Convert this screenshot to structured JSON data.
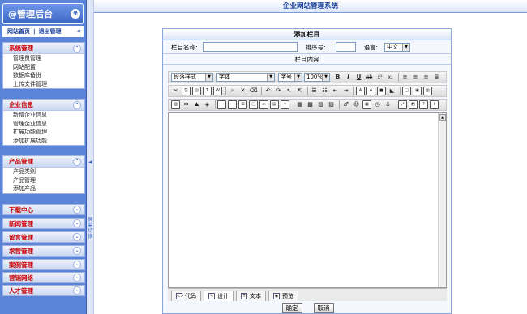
{
  "window": {
    "title": "企业网站管理系统"
  },
  "sidebar": {
    "brand": "@管理后台",
    "links": {
      "home": "网站首页",
      "sep": "|",
      "logout": "退出管理"
    },
    "groups": [
      {
        "title": "系统管理",
        "items": [
          "管理员管理",
          "网站配置",
          "数据库备份",
          "上传文件管理"
        ]
      },
      {
        "title": "企业信息",
        "items": [
          "新增企业信息",
          "管理企业信息",
          "扩展功能管理",
          "添加扩展功能"
        ]
      },
      {
        "title": "产品管理",
        "items": [
          "产品类别",
          "产品管理",
          "添加产品"
        ]
      }
    ],
    "collapsed": [
      "下载中心",
      "新闻管理",
      "留言管理",
      "求营管理",
      "案例管理",
      "营销网络",
      "人才管理"
    ],
    "splitter_text": "屏幕切换"
  },
  "form": {
    "title": "添加栏目",
    "name_label": "栏目名称:",
    "name_value": "",
    "order_label": "排序号:",
    "order_value": "",
    "lang_label": "语言:",
    "lang_value": "中文",
    "content_label": "栏目内容"
  },
  "editor": {
    "paragraph": "段落样式",
    "font": "字体",
    "size": "字号",
    "zoom": "100%",
    "tabs": [
      "代码",
      "设计",
      "文本",
      "预览"
    ]
  },
  "buttons": {
    "ok": "确定",
    "cancel": "取消"
  }
}
